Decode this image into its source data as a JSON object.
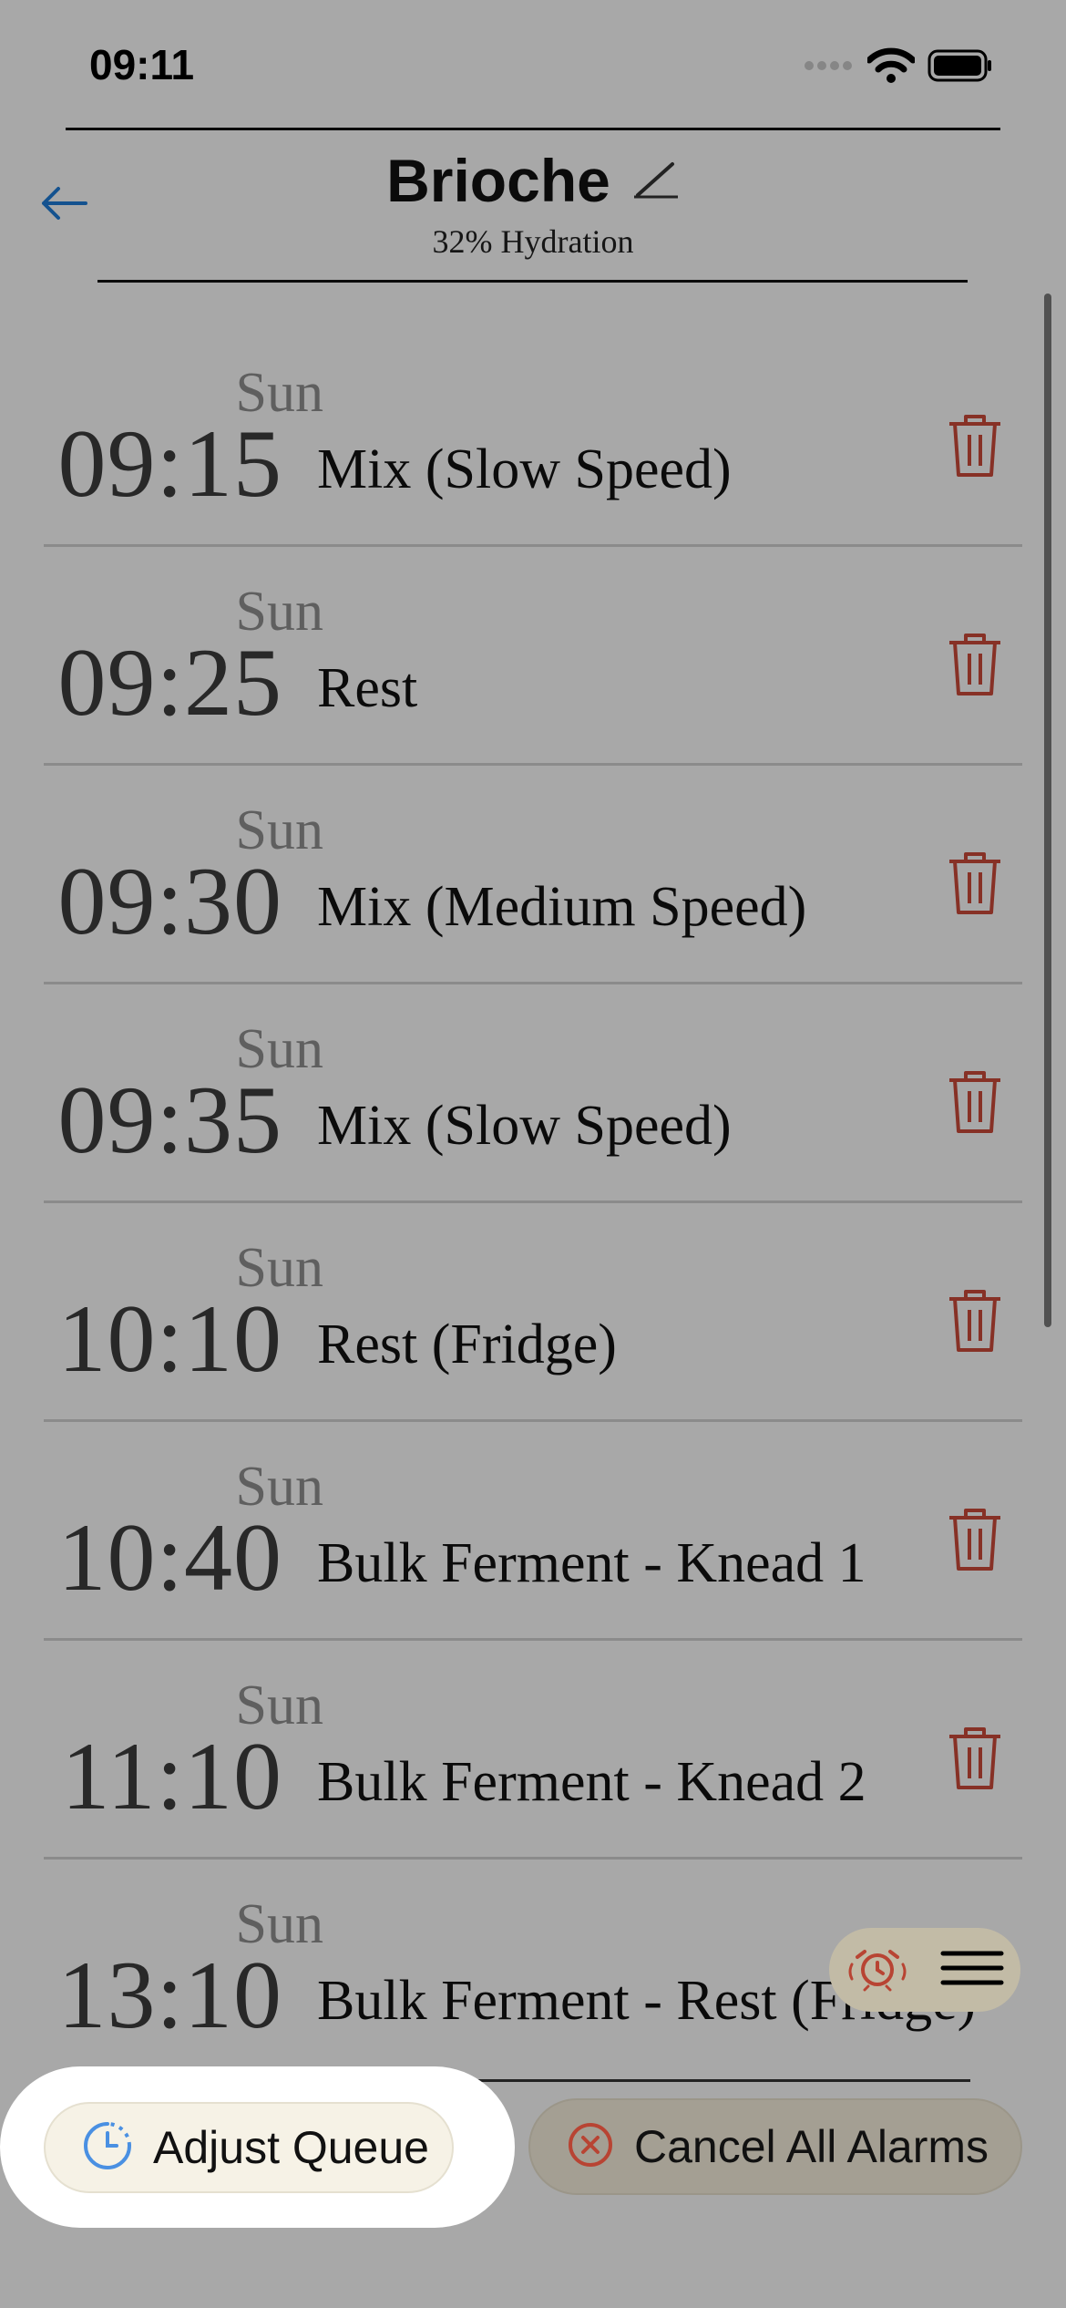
{
  "status_bar": {
    "time": "09:11",
    "icons": [
      "signal-icon",
      "wifi-icon",
      "battery-icon"
    ]
  },
  "header": {
    "title": "Brioche",
    "subtitle": "32% Hydration",
    "back_icon": "back-arrow-icon",
    "edit_icon": "pencil-icon"
  },
  "alarms": [
    {
      "day": "Sun",
      "time": "09:15",
      "label": "Mix (Slow Speed)"
    },
    {
      "day": "Sun",
      "time": "09:25",
      "label": "Rest"
    },
    {
      "day": "Sun",
      "time": "09:30",
      "label": "Mix (Medium Speed)"
    },
    {
      "day": "Sun",
      "time": "09:35",
      "label": "Mix (Slow Speed)"
    },
    {
      "day": "Sun",
      "time": "10:10",
      "label": "Rest (Fridge)"
    },
    {
      "day": "Sun",
      "time": "10:40",
      "label": "Bulk Ferment - Knead 1"
    },
    {
      "day": "Sun",
      "time": "11:10",
      "label": "Bulk Ferment - Knead 2"
    },
    {
      "day": "Sun",
      "time": "13:10",
      "label": "Bulk Ferment - Rest (Fridge)"
    }
  ],
  "fab": {
    "icons": [
      "alarm-icon",
      "menu-icon"
    ]
  },
  "actions": {
    "adjust_queue": "Adjust Queue",
    "cancel_all_alarms": "Cancel All Alarms"
  },
  "colors": {
    "accent_blue": "#1e7bd6",
    "delete_red": "#c94a3a",
    "adjust_bg": "#f6f2e6",
    "overlay": "rgba(0,0,0,0.33)"
  }
}
